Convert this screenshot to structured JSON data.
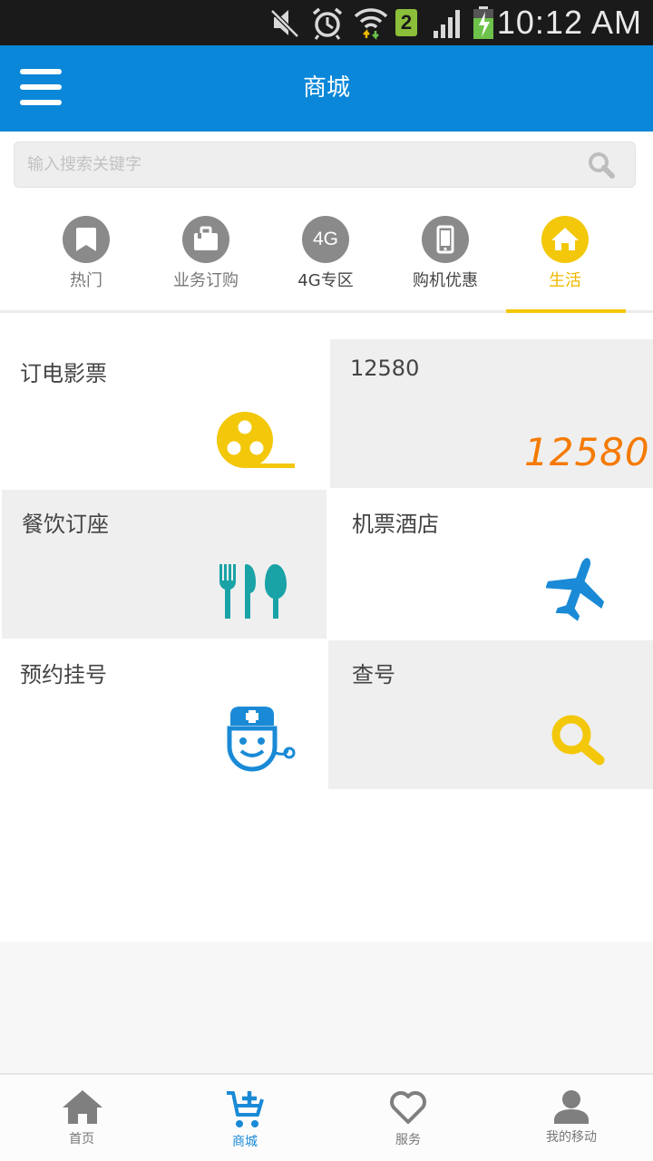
{
  "status_bar": {
    "time": "10:12 AM",
    "icons": [
      "mute-icon",
      "alarm-icon",
      "wifi-icon",
      "sim-2-badge",
      "signal-icon",
      "battery-charging-icon"
    ],
    "sim_badge": "2"
  },
  "header": {
    "title": "商城",
    "menu_icon": "hamburger-menu-icon",
    "color": "#0a87d8"
  },
  "search": {
    "placeholder": "输入搜索关键字",
    "value": "",
    "icon": "search-icon"
  },
  "categories": [
    {
      "label": "热门",
      "icon": "bookmark-icon",
      "active": false
    },
    {
      "label": "业务订购",
      "icon": "briefcase-icon",
      "active": false
    },
    {
      "label": "4G专区",
      "icon": "4g-icon",
      "icon_text": "4G",
      "active": false
    },
    {
      "label": "购机优惠",
      "icon": "phone-icon",
      "active": false
    },
    {
      "label": "生活",
      "icon": "home-icon",
      "active": true
    }
  ],
  "accent_color": "#f3c70a",
  "tiles": [
    {
      "label": "订电影票",
      "icon": "film-reel-icon"
    },
    {
      "label": "12580",
      "icon": "12580-logo",
      "logo_text": "12580",
      "logo_color": "#f57a00"
    },
    {
      "label": "餐饮订座",
      "icon": "cutlery-icon",
      "icon_color": "#1aa3a6"
    },
    {
      "label": "机票酒店",
      "icon": "airplane-icon",
      "icon_color": "#1a8ad6"
    },
    {
      "label": "预约挂号",
      "icon": "doctor-icon",
      "icon_color": "#1a8ad6"
    },
    {
      "label": "查号",
      "icon": "magnifier-icon",
      "icon_color": "#f3c70a"
    }
  ],
  "tab_bar": [
    {
      "label": "首页",
      "icon": "home-icon",
      "active": false
    },
    {
      "label": "商城",
      "icon": "cart-icon",
      "active": true
    },
    {
      "label": "服务",
      "icon": "heart-icon",
      "active": false
    },
    {
      "label": "我的移动",
      "icon": "person-icon",
      "active": false
    }
  ]
}
